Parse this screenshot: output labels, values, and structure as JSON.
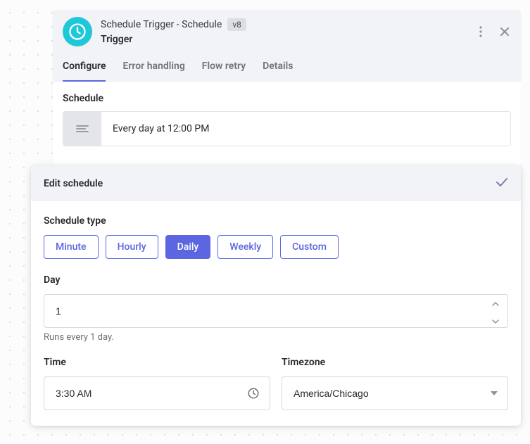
{
  "header": {
    "title": "Schedule Trigger - Schedule",
    "version": "v8",
    "subtitle": "Trigger"
  },
  "tabs": {
    "configure": "Configure",
    "error_handling": "Error handling",
    "flow_retry": "Flow retry",
    "details": "Details"
  },
  "schedule": {
    "label": "Schedule",
    "value": "Every day at 12:00 PM"
  },
  "edit": {
    "title": "Edit schedule",
    "type_label": "Schedule type",
    "types": {
      "minute": "Minute",
      "hourly": "Hourly",
      "daily": "Daily",
      "weekly": "Weekly",
      "custom": "Custom"
    },
    "day_label": "Day",
    "day_value": "1",
    "day_hint": "Runs every 1 day.",
    "time_label": "Time",
    "time_value": "3:30 AM",
    "timezone_label": "Timezone",
    "timezone_value": "America/Chicago"
  }
}
